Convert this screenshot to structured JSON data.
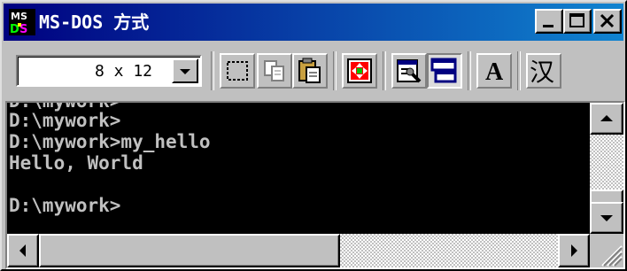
{
  "window": {
    "title": "MS-DOS 方式",
    "icon": "ms-dos-icon"
  },
  "caption_buttons": [
    "minimize-icon",
    "maximize-icon",
    "close-icon"
  ],
  "toolbar": {
    "font_size_value": "8 x 12",
    "buttons": [
      {
        "name": "mark-button",
        "icon": "mark-icon"
      },
      {
        "name": "copy-button",
        "icon": "copy-icon"
      },
      {
        "name": "paste-button",
        "icon": "paste-icon"
      },
      {
        "name": "fullscreen-button",
        "icon": "fullscreen-icon"
      },
      {
        "name": "properties-button",
        "icon": "properties-icon"
      },
      {
        "name": "background-button",
        "icon": "background-icon"
      },
      {
        "name": "font-button",
        "icon": "font-icon",
        "label": "A"
      },
      {
        "name": "ime-button",
        "icon": "ime-icon",
        "label": "汉"
      }
    ]
  },
  "console": {
    "lines": [
      "D:\\mywork>",
      "D:\\mywork>my_hello",
      "Hello, World",
      "",
      "D:\\mywork>"
    ],
    "text_color": "#c0c0c0",
    "background": "#000000"
  },
  "scrollbars": {
    "vertical_thumb_position": 0.9,
    "horizontal_thumb_position": 0.0
  }
}
